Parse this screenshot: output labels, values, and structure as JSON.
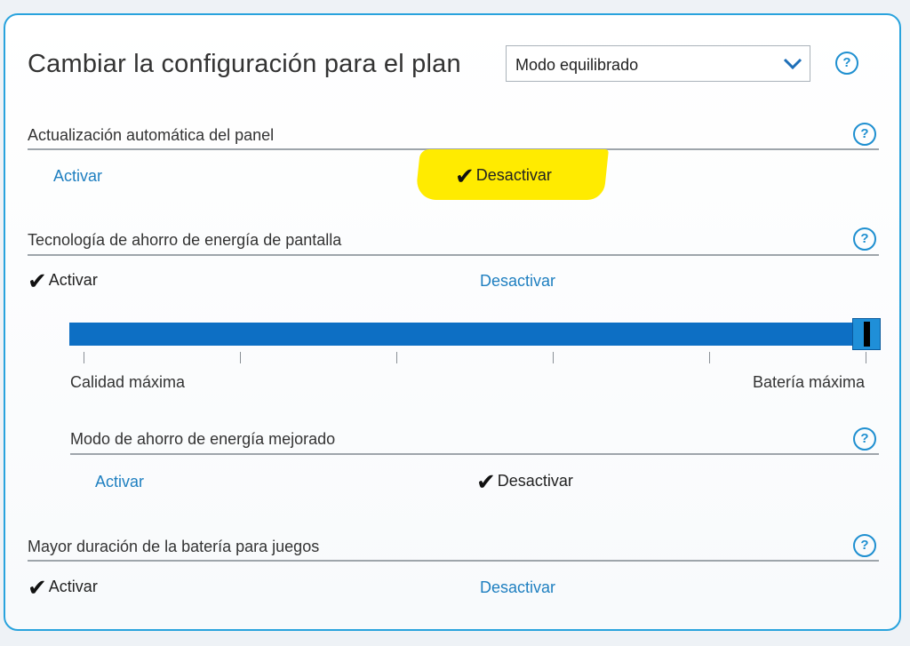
{
  "header": {
    "title": "Cambiar la configuración para el plan",
    "plan_select_value": "Modo equilibrado"
  },
  "sections": {
    "panel_refresh": {
      "title": "Actualización automática del panel",
      "option_on": "Activar",
      "option_off": "Desactivar",
      "selected": "Desactivar"
    },
    "display_power": {
      "title": "Tecnología de ahorro de energía de pantalla",
      "option_on": "Activar",
      "option_off": "Desactivar",
      "selected": "Activar",
      "slider": {
        "min_label": "Calidad máxima",
        "max_label": "Batería máxima",
        "ticks": 6,
        "value_fraction": 1.0
      }
    },
    "enhanced_saving": {
      "title": "Modo de ahorro de energía mejorado",
      "option_on": "Activar",
      "option_off": "Desactivar",
      "selected": "Desactivar"
    },
    "gaming_battery": {
      "title": "Mayor duración de la batería para juegos",
      "option_on": "Activar",
      "option_off": "Desactivar",
      "selected": "Activar"
    }
  },
  "help_icon_glyph": "?",
  "check_glyph": "✔",
  "colors": {
    "accent": "#1e7fc0",
    "border": "#29a3dd",
    "slider": "#0d6fc4",
    "highlight": "#ffeb00"
  }
}
